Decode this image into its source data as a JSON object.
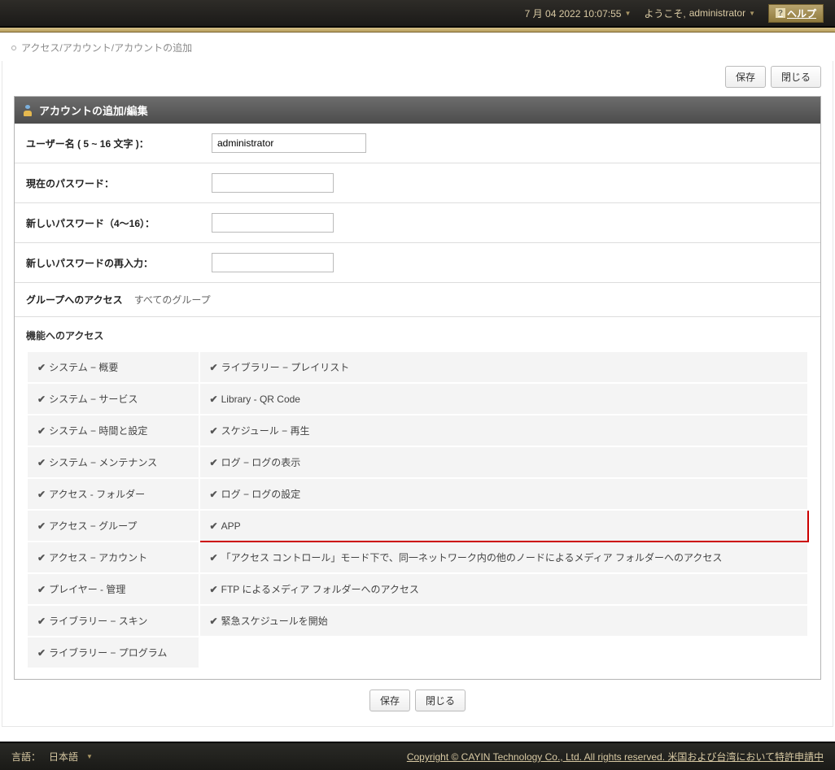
{
  "topbar": {
    "datetime": "7 月 04 2022 10:07:55",
    "welcome_prefix": "ようこそ, ",
    "user": "administrator",
    "help_label": "ヘルプ"
  },
  "breadcrumb": "アクセス/アカウント/アカウントの追加",
  "buttons": {
    "save": "保存",
    "close": "閉じる"
  },
  "panel_title": "アカウントの追加/編集",
  "form": {
    "username_label": "ユーザー名 ( 5 ~ 16 文字 )：",
    "username_value": "administrator",
    "current_pw_label": "現在のパスワード：",
    "new_pw_label": "新しいパスワード（4～16）：",
    "confirm_pw_label": "新しいパスワードの再入力：",
    "group_access_label": "グループへのアクセス",
    "group_access_value": "すべてのグループ"
  },
  "feature_access_title": "機能へのアクセス",
  "perms": {
    "left": [
      "システム − 概要",
      "システム − サービス",
      "システム − 時間と設定",
      "システム − メンテナンス",
      "アクセス - フォルダー",
      "アクセス − グループ",
      "アクセス − アカウント",
      "プレイヤー - 管理",
      "ライブラリー − スキン",
      "ライブラリー − プログラム"
    ],
    "right": [
      "ライブラリー − プレイリスト",
      "Library - QR Code",
      "スケジュール − 再生",
      "ログ − ログの表示",
      "ログ − ログの設定",
      "APP",
      "「アクセス コントロール」モード下で、同一ネットワーク内の他のノードによるメディア フォルダーへのアクセス",
      "FTP によるメディア フォルダーへのアクセス",
      "緊急スケジュールを開始"
    ]
  },
  "footer": {
    "lang_label": "言語：",
    "lang_value": "日本語",
    "copyright": "Copyright © CAYIN Technology Co., Ltd. All rights reserved.   米国および台湾において特許申請中"
  }
}
